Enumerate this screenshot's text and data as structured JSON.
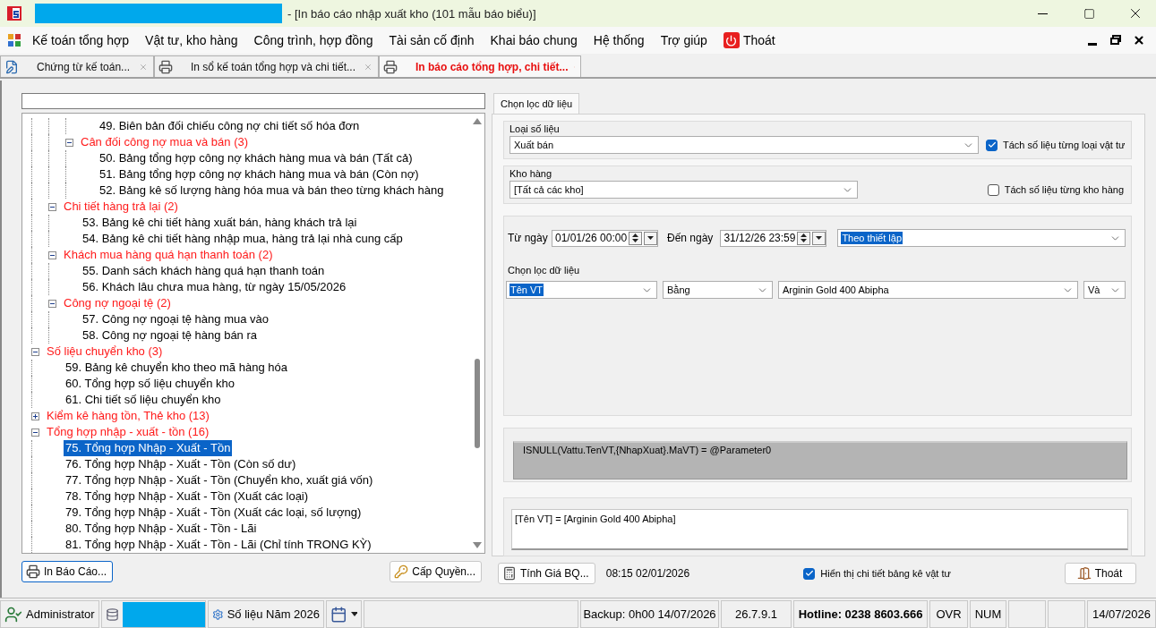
{
  "window": {
    "title": "- [In báo cáo nhập xuất kho (101 mẫu báo biểu)]"
  },
  "menu": [
    {
      "label": "Kế toán tổng hợp",
      "kind": "menu"
    },
    {
      "label": "Vật tư, kho hàng",
      "kind": "menu"
    },
    {
      "label": "Công trình, hợp đồng",
      "kind": "menu"
    },
    {
      "label": "Tài sản cố định",
      "kind": "menu"
    },
    {
      "label": "Khai báo chung",
      "kind": "menu"
    },
    {
      "label": "Hệ thống",
      "kind": "menu"
    },
    {
      "label": "Trợ giúp",
      "kind": "menu"
    },
    {
      "label": "Thoát",
      "kind": "exit"
    }
  ],
  "tabs": [
    {
      "label": "Chứng từ kế toán...",
      "selected": false,
      "kind": "voucher"
    },
    {
      "label": "In sổ kế toán tổng hợp và chi tiết...",
      "selected": false,
      "kind": "print"
    },
    {
      "label": "In báo cáo tổng hợp, chi tiết...",
      "selected": true,
      "kind": "print"
    }
  ],
  "tree": {
    "items": [
      {
        "children": [
          {
            "children": [
              {
                "children": [
                  {
                    "kind": "report",
                    "label": "49. Biên bản đối chiếu công nợ chi tiết số hóa đơn",
                    "selected": false
                  }
                ]
              },
              {
                "kind": "group",
                "label": "Cân đối công nợ mua và bán (3)",
                "expanded": true,
                "selected": false,
                "children": [
                  {
                    "kind": "report",
                    "label": "50. Bảng tổng hợp công nợ khách hàng mua và bán (Tất cả)",
                    "selected": false
                  },
                  {
                    "kind": "report",
                    "label": "51. Bảng tổng hợp công nợ khách hàng mua và bán (Còn nợ)",
                    "selected": false
                  },
                  {
                    "kind": "report",
                    "label": "52. Bảng kê số lượng hàng hóa mua và bán theo từng khách hàng",
                    "selected": false
                  }
                ]
              }
            ]
          },
          {
            "kind": "group",
            "label": "Chi tiết hàng trả lại (2)",
            "expanded": true,
            "selected": false,
            "children": [
              {
                "kind": "report",
                "label": "53. Bảng kê chi tiết hàng xuất bán, hàng khách trả lại",
                "selected": false
              },
              {
                "kind": "report",
                "label": "54. Bảng kê chi tiết hàng nhập mua, hàng trả lại nhà cung cấp",
                "selected": false
              }
            ]
          },
          {
            "kind": "group",
            "label": "Khách mua hàng quá hạn thanh toán (2)",
            "expanded": true,
            "selected": false,
            "children": [
              {
                "kind": "report",
                "label": "55. Danh sách khách hàng quá hạn thanh toán",
                "selected": false
              },
              {
                "kind": "report",
                "label": "56. Khách lâu chưa mua hàng, từ ngày 15/05/2026",
                "selected": false
              }
            ]
          },
          {
            "kind": "group",
            "label": "Công nợ ngoại tệ (2)",
            "expanded": true,
            "selected": false,
            "children": [
              {
                "kind": "report",
                "label": "57. Công nợ ngoại tệ hàng mua vào",
                "selected": false
              },
              {
                "kind": "report",
                "label": "58. Công nợ ngoại tệ hàng bán ra",
                "selected": false
              }
            ]
          }
        ]
      },
      {
        "kind": "group",
        "label": "Số liệu chuyển kho (3)",
        "expanded": true,
        "selected": false,
        "children": [
          {
            "kind": "report",
            "label": "59. Bảng kê chuyển kho theo mã hàng hóa",
            "selected": false
          },
          {
            "kind": "report",
            "label": "60. Tổng hợp số liệu chuyển kho",
            "selected": false
          },
          {
            "kind": "report",
            "label": "61. Chi tiết số liệu chuyển kho",
            "selected": false
          }
        ]
      },
      {
        "kind": "group",
        "label": "Kiểm kê hàng tồn, Thẻ kho (13)",
        "expanded": false,
        "selected": false
      },
      {
        "kind": "group",
        "label": "Tổng hợp nhập - xuất - tồn (16)",
        "expanded": true,
        "selected": false,
        "children": [
          {
            "kind": "report",
            "label": "75. Tổng hợp Nhập - Xuất - Tồn",
            "selected": true
          },
          {
            "kind": "report",
            "label": "76. Tổng hợp Nhập - Xuất - Tồn (Còn số dư)",
            "selected": false
          },
          {
            "kind": "report",
            "label": "77. Tổng hợp Nhập - Xuất - Tồn (Chuyển kho, xuất giá vốn)",
            "selected": false
          },
          {
            "kind": "report",
            "label": "78. Tổng hợp Nhập - Xuất - Tồn (Xuất các loại)",
            "selected": false
          },
          {
            "kind": "report",
            "label": "79. Tổng hợp Nhập - Xuất - Tồn (Xuất các loại, số lượng)",
            "selected": false
          },
          {
            "kind": "report",
            "label": "80. Tổng hợp Nhập - Xuất - Tồn - Lãi",
            "selected": false
          },
          {
            "kind": "report",
            "label": "81. Tổng hợp Nhập - Xuất - Tồn - Lãi (Chỉ tính TRONG KỲ)",
            "selected": false
          }
        ]
      }
    ]
  },
  "left_buttons": [
    {
      "label": "In Báo Cáo...",
      "kind": "print",
      "focused": true
    },
    {
      "label": "Cấp Quyền...",
      "kind": "permission",
      "focused": false
    }
  ],
  "filter_panel": {
    "tab": {
      "label": "Chọn lọc dữ liệu",
      "selected": true
    },
    "data_type": {
      "label": "Loại số liệu",
      "value": "Xuất bán",
      "split": {
        "label": "Tách số liệu từng loại vật tư",
        "checked": true
      }
    },
    "warehouse": {
      "label": "Kho hàng",
      "value": "[Tất cả các kho]",
      "split": {
        "label": "Tách số liệu từng kho hàng",
        "checked": false
      }
    },
    "period": {
      "from_label": "Từ ngày",
      "from": "01/01/26 00:00",
      "to_label": "Đến ngày",
      "to": "31/12/26 23:59",
      "preset": {
        "value": "Theo thiết lập",
        "highlighted": true
      }
    },
    "filter": {
      "label": "Chọn lọc dữ liệu",
      "conditions": [
        {
          "value": "Tên VT",
          "highlighted": true
        },
        {
          "value": "Bằng",
          "highlighted": false
        },
        {
          "value": "Arginin Gold 400 Abipha",
          "highlighted": false
        },
        {
          "value": "Và",
          "highlighted": false
        }
      ]
    },
    "expression": "ISNULL(Vattu.TenVT,{NhapXuat}.MaVT) = @Parameter0",
    "description": "[Tên VT] = [Arginin Gold 400 Abipha]"
  },
  "bottom": {
    "calc_button": "Tính Giá BQ...",
    "timestamp": "08:15 02/01/2026",
    "show_detail": {
      "label": "Hiển thị chi tiết bảng kê vật tư",
      "checked": true
    },
    "exit_button": "Thoát"
  },
  "status_bar": [
    {
      "kind": "user",
      "text": "Administrator"
    },
    {
      "kind": "database"
    },
    {
      "kind": "year",
      "text": "Số liệu Năm 2026"
    },
    {
      "kind": "calendar"
    },
    {
      "kind": "empty"
    },
    {
      "kind": "text",
      "text": "Backup: 0h00 14/07/2026"
    },
    {
      "kind": "text",
      "text": "26.7.9.1"
    },
    {
      "kind": "hotline",
      "text": "Hotline: 0238 8603.666"
    },
    {
      "kind": "text",
      "text": "OVR"
    },
    {
      "kind": "text",
      "text": "NUM"
    },
    {
      "kind": "empty"
    },
    {
      "kind": "empty"
    },
    {
      "kind": "text",
      "text": "14/07/2026"
    }
  ]
}
